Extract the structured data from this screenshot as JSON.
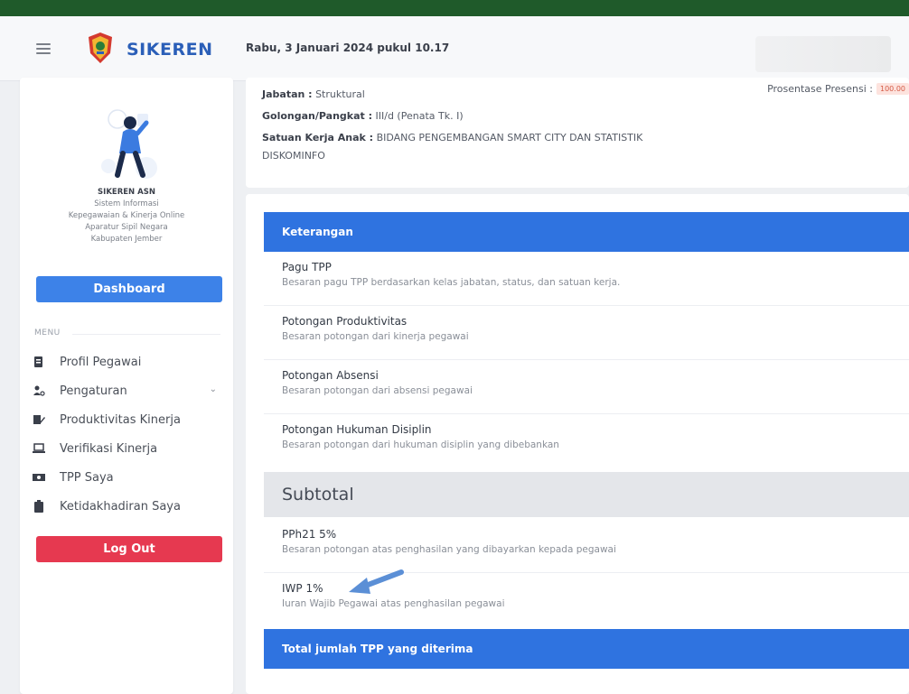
{
  "header": {
    "brand": "SIKEREN",
    "datetime": "Rabu, 3 Januari 2024 pukul 10.17"
  },
  "sidebar": {
    "app_title": "SIKEREN ASN",
    "app_desc_1": "Sistem Informasi",
    "app_desc_2": "Kepegawaian & Kinerja Online",
    "app_desc_3": "Aparatur Sipil Negara",
    "app_desc_4": "Kabupaten Jember",
    "dashboard_label": "Dashboard",
    "menu_title": "MENU",
    "items": [
      {
        "label": "Profil Pegawai",
        "icon": "id-card-icon"
      },
      {
        "label": "Pengaturan",
        "icon": "users-cog-icon"
      },
      {
        "label": "Produktivitas Kinerja",
        "icon": "edit-icon"
      },
      {
        "label": "Verifikasi Kinerja",
        "icon": "laptop-check-icon"
      },
      {
        "label": "TPP Saya",
        "icon": "money-icon"
      },
      {
        "label": "Ketidakhadiran Saya",
        "icon": "clipboard-icon"
      }
    ],
    "logout_label": "Log Out"
  },
  "profile": {
    "jabatan_label": "Jabatan :",
    "jabatan_value": "Struktural",
    "golongan_label": "Golongan/Pangkat :",
    "golongan_value": "III/d (Penata Tk. I)",
    "satuan_label": "Satuan Kerja Anak :",
    "satuan_value": "BIDANG PENGEMBANGAN SMART CITY DAN STATISTIK",
    "satuan_value_2": "DISKOMINFO",
    "presensi_label": "Prosentase Presensi :",
    "presensi_value": "100.00"
  },
  "main": {
    "keterangan_header": "Keterangan",
    "rows": [
      {
        "title": "Pagu TPP",
        "desc": "Besaran pagu TPP berdasarkan kelas jabatan, status, dan satuan kerja."
      },
      {
        "title": "Potongan Produktivitas",
        "desc": "Besaran potongan dari kinerja pegawai"
      },
      {
        "title": "Potongan Absensi",
        "desc": "Besaran potongan dari absensi pegawai"
      },
      {
        "title": "Potongan Hukuman Disiplin",
        "desc": "Besaran potongan dari hukuman disiplin yang dibebankan"
      }
    ],
    "subtotal_label": "Subtotal",
    "rows_after": [
      {
        "title": "PPh21 5%",
        "desc": "Besaran potongan atas penghasilan yang dibayarkan kepada pegawai"
      },
      {
        "title": "IWP 1%",
        "desc": "Iuran Wajib Pegawai atas penghasilan pegawai"
      }
    ],
    "total_header": "Total jumlah TPP yang diterima"
  },
  "colors": {
    "accent_blue": "#2f73e0",
    "logout_red": "#e63950",
    "top_green": "#1f5a2a"
  }
}
